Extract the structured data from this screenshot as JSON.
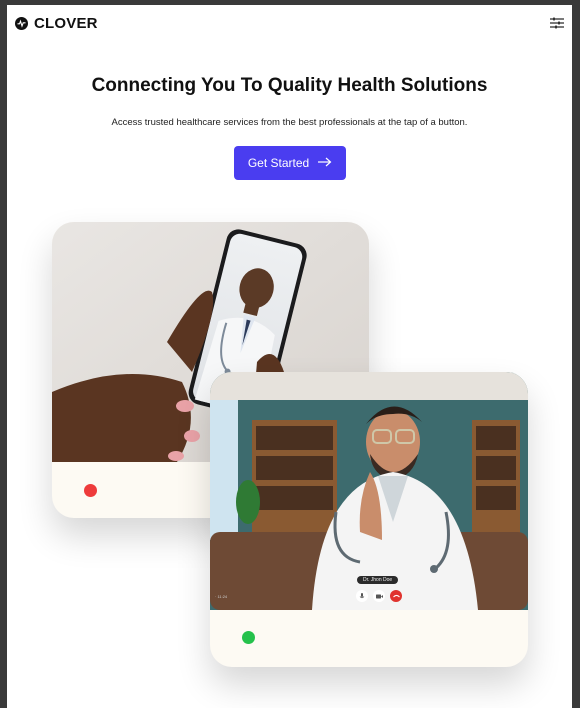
{
  "brand": {
    "name": "CLOVER",
    "icon": "pulse-logo-icon"
  },
  "nav": {
    "menu_icon": "menu-sliders-icon"
  },
  "hero": {
    "title": "Connecting You To Quality Health Solutions",
    "subtitle": "Access trusted healthcare services from the best professionals at the tap of a button.",
    "cta_label": "Get Started",
    "cta_icon": "arrow-right-icon"
  },
  "cards": [
    {
      "status_color": "#ee3b3b"
    },
    {
      "status_color": "#25c14b",
      "call_name": "Dr. Jhon Doe"
    }
  ],
  "colors": {
    "accent": "#4a3df0",
    "card_bg": "#fdfaf3"
  }
}
